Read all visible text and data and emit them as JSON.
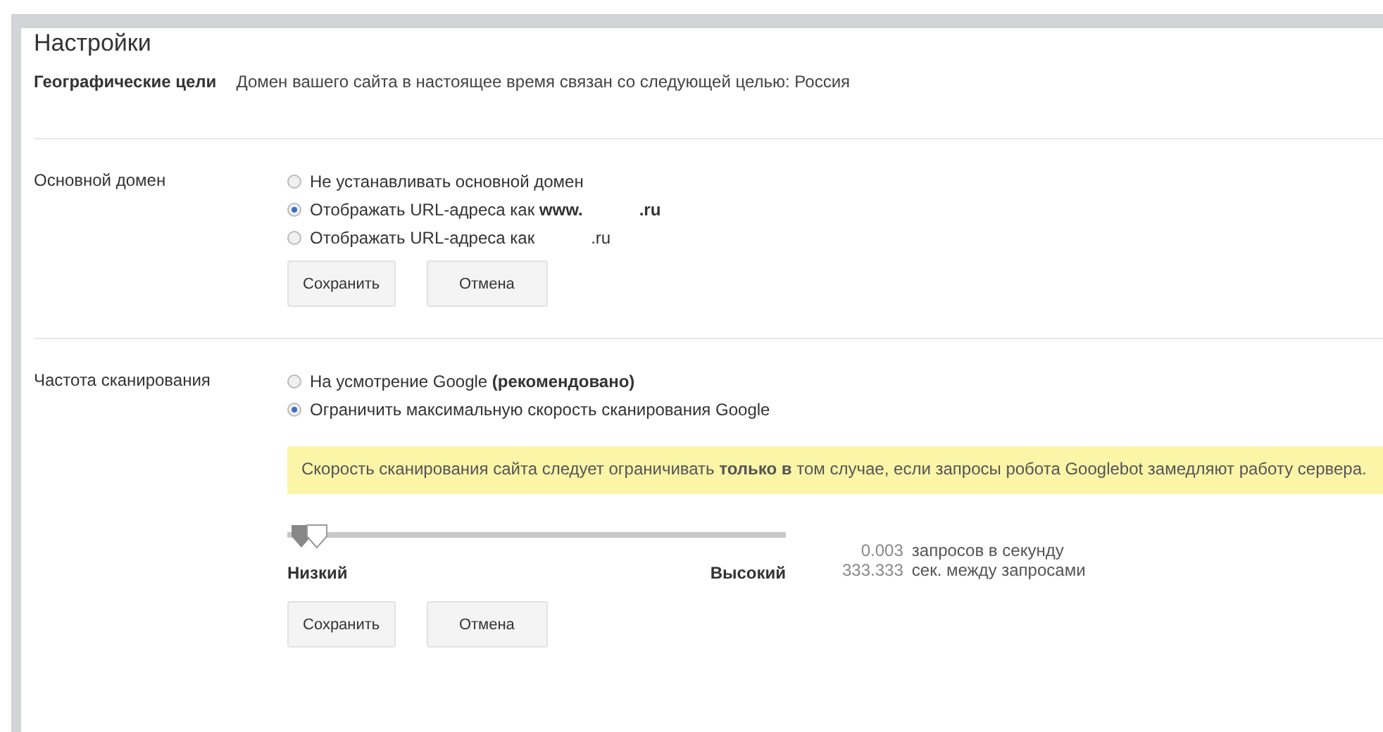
{
  "title": "Настройки",
  "geo": {
    "label": "Географические цели",
    "text": "Домен вашего сайта в настоящее время связан со следующей целью: Россия"
  },
  "domain": {
    "label": "Основной домен",
    "options": [
      {
        "label": "Не устанавливать основной домен",
        "selected": false
      },
      {
        "label": "Отображать URL-адреса как **www.**",
        "suffix": "**.ru**",
        "selected": true
      },
      {
        "label": "Отображать URL-адреса как",
        "suffix": ".ru",
        "selected": false
      }
    ],
    "buttons": [
      "Сохранить",
      "Отмена"
    ]
  },
  "crawl": {
    "label": "Частота сканирования",
    "options": [
      {
        "label": "На усмотрение Google **(рекомендовано)**",
        "selected": false
      },
      {
        "label": "Ограничить максимальную скорость сканирования Google",
        "selected": true
      }
    ],
    "notice": "Скорость сканирования сайта следует ограничивать **только в** том случае, если запросы робота Googlebot замедляют работу сервера.",
    "slider": {
      "level": 0.06,
      "min_label": "Низкий",
      "max_label": "Высокий"
    },
    "readings": [
      {
        "value": "0.003",
        "unit": "запросов в секунду"
      },
      {
        "value": "333.333",
        "unit": "сек. между запросами"
      }
    ],
    "buttons": [
      "Сохранить",
      "Отмена"
    ]
  }
}
